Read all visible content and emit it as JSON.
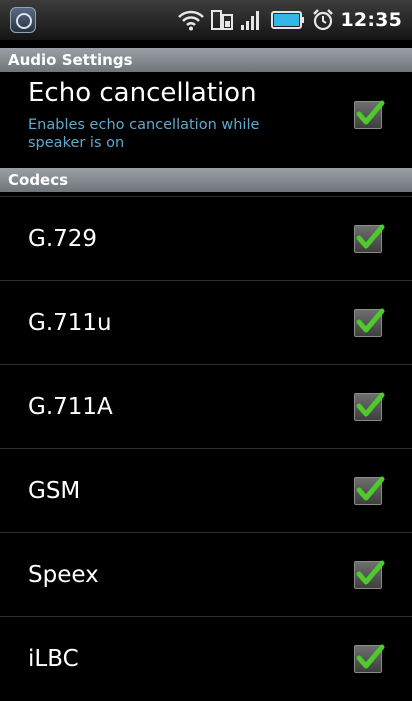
{
  "status_bar": {
    "time": "12:35",
    "icons": [
      "app-notification-icon",
      "wifi-icon",
      "data-transfer-icon",
      "signal-bars-icon",
      "battery-icon",
      "alarm-clock-icon"
    ]
  },
  "sections": {
    "audio_header": "Audio Settings",
    "codecs_header": "Codecs"
  },
  "echo": {
    "title": "Echo cancellation",
    "summary": "Enables echo cancellation while speaker is on",
    "checked": true
  },
  "codecs": [
    {
      "label": "G.729",
      "checked": true
    },
    {
      "label": "G.711u",
      "checked": true
    },
    {
      "label": "G.711A",
      "checked": true
    },
    {
      "label": "GSM",
      "checked": true
    },
    {
      "label": "Speex",
      "checked": true
    },
    {
      "label": "iLBC",
      "checked": true
    }
  ],
  "colors": {
    "check_green": "#4ecb2a",
    "summary_blue": "#5fa9cf",
    "header_gray": "#878d93"
  }
}
